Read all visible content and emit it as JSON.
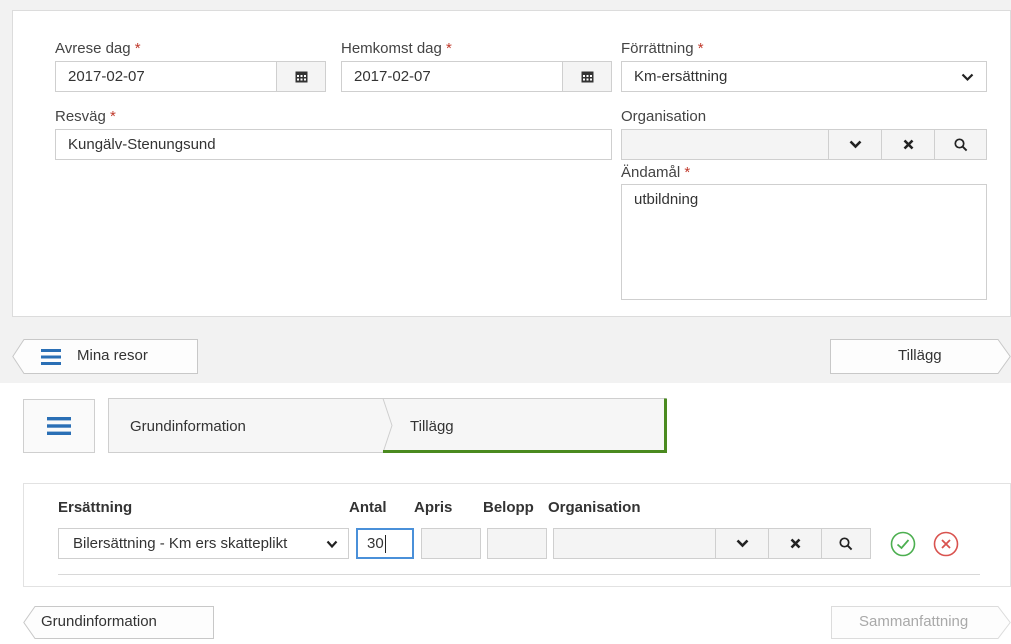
{
  "trip_form": {
    "departure": {
      "label": "Avrese dag",
      "required": "*",
      "value": "2017-02-07"
    },
    "return": {
      "label": "Hemkomst dag",
      "required": "*",
      "value": "2017-02-07"
    },
    "errand": {
      "label": "Förrättning",
      "required": "*",
      "value": "Km-ersättning"
    },
    "route": {
      "label": "Resväg",
      "required": "*",
      "value": "Kungälv-Stenungsund"
    },
    "organisation": {
      "label": "Organisation",
      "value": ""
    },
    "purpose": {
      "label": "Ändamål",
      "required": "*",
      "value": "utbildning"
    }
  },
  "nav1": {
    "back_label": "Mina resor",
    "next_label": "Tillägg"
  },
  "wizard": {
    "step1": "Grundinformation",
    "step2": "Tillägg"
  },
  "additions": {
    "headers": {
      "compensation": "Ersättning",
      "quantity": "Antal",
      "unit_price": "Apris",
      "amount": "Belopp",
      "organisation": "Organisation"
    },
    "row": {
      "compensation": "Bilersättning - Km ers skatteplikt",
      "quantity": "30",
      "unit_price": "",
      "amount": "",
      "organisation": ""
    }
  },
  "nav2": {
    "back_label": "Grundinformation",
    "next_label": "Sammanfattning"
  },
  "colors": {
    "required": "#c0392b",
    "accent_blue": "#2a6fb5",
    "accept_green": "#4caf50",
    "cancel_red": "#d9534f",
    "active_step": "#4a8a1f"
  },
  "icons": {
    "calendar": "calendar-icon",
    "chevron": "chevron-down-icon",
    "clear": "clear-icon",
    "search": "search-icon",
    "menu": "menu-icon",
    "accept": "check-circle-icon",
    "cancel": "cancel-circle-icon"
  }
}
